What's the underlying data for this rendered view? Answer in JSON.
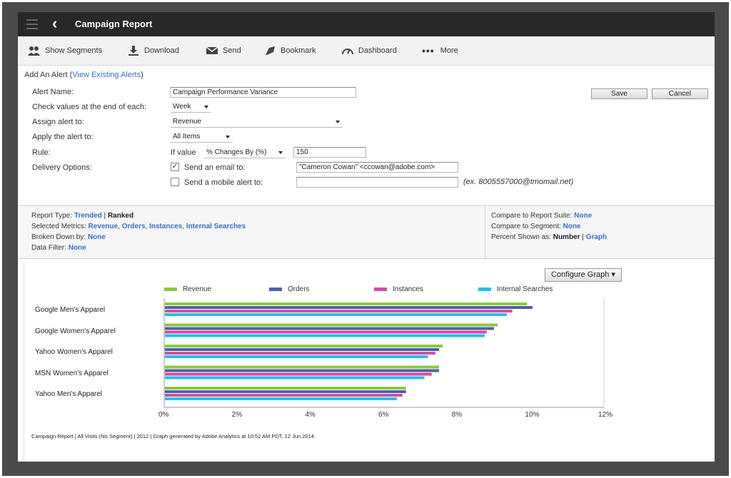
{
  "app": {
    "title": "Campaign Report"
  },
  "toolbar": {
    "items": [
      {
        "label": "Show Segments",
        "icon": "segments-icon"
      },
      {
        "label": "Download",
        "icon": "download-icon"
      },
      {
        "label": "Send",
        "icon": "envelope-icon"
      },
      {
        "label": "Bookmark",
        "icon": "bookmark-icon"
      },
      {
        "label": "Dashboard",
        "icon": "gauge-icon"
      },
      {
        "label": "More",
        "icon": "more-dots-icon"
      }
    ]
  },
  "alert": {
    "heading": "Add An Alert",
    "view_link": "View Existing Alerts",
    "name_label": "Alert Name:",
    "name_value": "Campaign Performance Variance",
    "check_label": "Check values at the end of each:",
    "check_value": "Week",
    "assign_label": "Assign alert to:",
    "assign_value": "Revenue",
    "apply_label": "Apply the alert to:",
    "apply_value": "All Items",
    "rule_label": "Rule:",
    "rule_prefix": "If value",
    "rule_condition": "% Changes By (%)",
    "rule_amount": "150",
    "delivery_label": "Delivery Options:",
    "email_label": "Send an email to:",
    "email_checked": true,
    "email_value": "\"Cameron Cowan\" <ccowan@adobe.com>",
    "mobile_label": "Send a mobile alert to:",
    "mobile_checked": false,
    "mobile_value": "",
    "mobile_hint": "(ex. 8005557000@tmomail.net)",
    "save_label": "Save",
    "cancel_label": "Cancel"
  },
  "summary": {
    "report_type_label": "Report Type:",
    "report_type_trended": "Trended",
    "report_type_sep": "|",
    "report_type_ranked": "Ranked",
    "metrics_label": "Selected Metrics:",
    "metrics": [
      "Revenue",
      "Orders",
      "Instances",
      "Internal Searches"
    ],
    "broken_label": "Broken Down by:",
    "broken_value": "None",
    "filter_label": "Data Filter:",
    "filter_value": "None",
    "compare_suite_label": "Compare to Report Suite:",
    "compare_suite_value": "None",
    "compare_segment_label": "Compare to Segment:",
    "compare_segment_value": "None",
    "percent_label": "Percent Shown as:",
    "percent_number": "Number",
    "percent_sep": "|",
    "percent_graph": "Graph"
  },
  "graph": {
    "configure_label": "Configure Graph",
    "footer": "Campaign Report | All Visits (No Segment) | 2012 | Graph generated by Adobe Analytics at 10:52 AM PDT, 12 Jun 2014"
  },
  "chart_data": {
    "type": "bar",
    "orientation": "horizontal",
    "title": "",
    "xlabel": "",
    "ylabel": "",
    "categories": [
      "Google Men's Apparel",
      "Google Women's Apparel",
      "Yahoo Women's Apparel",
      "MSN Women's Apparel",
      "Yahoo Men's Apparel"
    ],
    "series": [
      {
        "name": "Revenue",
        "color": "#8cc63f",
        "values": [
          9.9,
          9.1,
          7.6,
          7.5,
          6.6
        ]
      },
      {
        "name": "Orders",
        "color": "#4f5fa8",
        "values": [
          10.05,
          9.0,
          7.5,
          7.5,
          6.6
        ]
      },
      {
        "name": "Instances",
        "color": "#d64aa0",
        "values": [
          9.5,
          8.8,
          7.4,
          7.3,
          6.5
        ]
      },
      {
        "name": "Internal Searches",
        "color": "#1fc3dd",
        "values": [
          9.35,
          8.75,
          7.2,
          7.1,
          6.35
        ]
      }
    ],
    "xlim": [
      0,
      12
    ],
    "ticks": [
      "0%",
      "2%",
      "4%",
      "6%",
      "8%",
      "10%",
      "12%"
    ],
    "legend_position": "top",
    "grid": false
  }
}
